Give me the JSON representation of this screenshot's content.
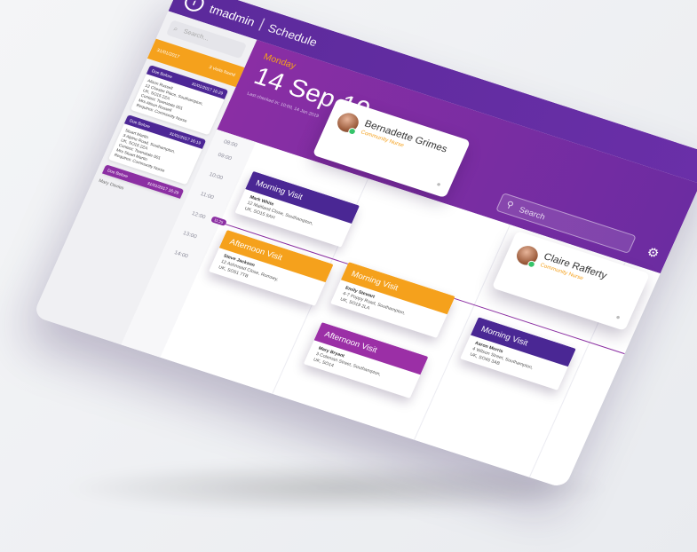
{
  "header": {
    "brand": "tmadmin",
    "section": "Schedule"
  },
  "sidebar": {
    "search_placeholder": "Search...",
    "orange_bar": {
      "left": "31/01/2017",
      "right": "3 visits found"
    },
    "cards": [
      {
        "head_left": "Due Before",
        "head_right": "31/01/2017 16:29",
        "lines": [
          "Alison Russell",
          "12 Chester Place, Southampton,",
          "UK, SO15 2ZA",
          "Contact: Townstate 001",
          "Mrs Alison Russell",
          "Requires: Community Nurse"
        ]
      },
      {
        "head_left": "Due Before",
        "head_right": "31/01/2017 16:19",
        "lines": [
          "Stuart Martin",
          "3 Alpine Road, Southampton,",
          "UK, SO15 2ZA",
          "Contact: Townstate 001",
          "Mrs Stuart Martin",
          "Requires: Community Nurse"
        ]
      },
      {
        "head_left": "Due Before",
        "head_right": "31/01/2017 16:29",
        "lines": []
      }
    ],
    "footer_name": "Mary Davies"
  },
  "hero": {
    "day": "Monday",
    "date": "14 Sep 19",
    "subtitle": "Last checked in: 10:00, 14 Jan 2019"
  },
  "search": {
    "placeholder": "Search"
  },
  "staff": [
    {
      "name": "Bernadette Grimes",
      "role": "Community Nurse"
    },
    {
      "name": "Claire Rafferty",
      "role": "Community Nurse"
    }
  ],
  "times": [
    "08:00",
    "09:00",
    "10:00",
    "11:00",
    "12:00",
    "13:00",
    "14:00"
  ],
  "now_label": "11:25",
  "visits": [
    {
      "title": "Morning Visit",
      "name": "Mark White",
      "addr1": "12 Maitland Close, Southampton,",
      "addr2": "UK, SO15 5AH"
    },
    {
      "title": "Afternoon Visit",
      "name": "Steve Jackson",
      "addr1": "12 Ashmead Close, Romsey,",
      "addr2": "UK, SO51 7TB"
    },
    {
      "title": "Morning Visit",
      "name": "Emily Stewart",
      "addr1": "4-7 Poppy Road, Southampton,",
      "addr2": "UK, SO19 2LA"
    },
    {
      "title": "Afternoon Visit",
      "name": "Mary Bryant",
      "addr1": "3 Coleman Street, Southampton,",
      "addr2": "UK, SO14"
    },
    {
      "title": "Morning Visit",
      "name": "Aaron Morris",
      "addr1": "4 Wilson Street, Southampton,",
      "addr2": "UK, SO45 3AB"
    }
  ]
}
